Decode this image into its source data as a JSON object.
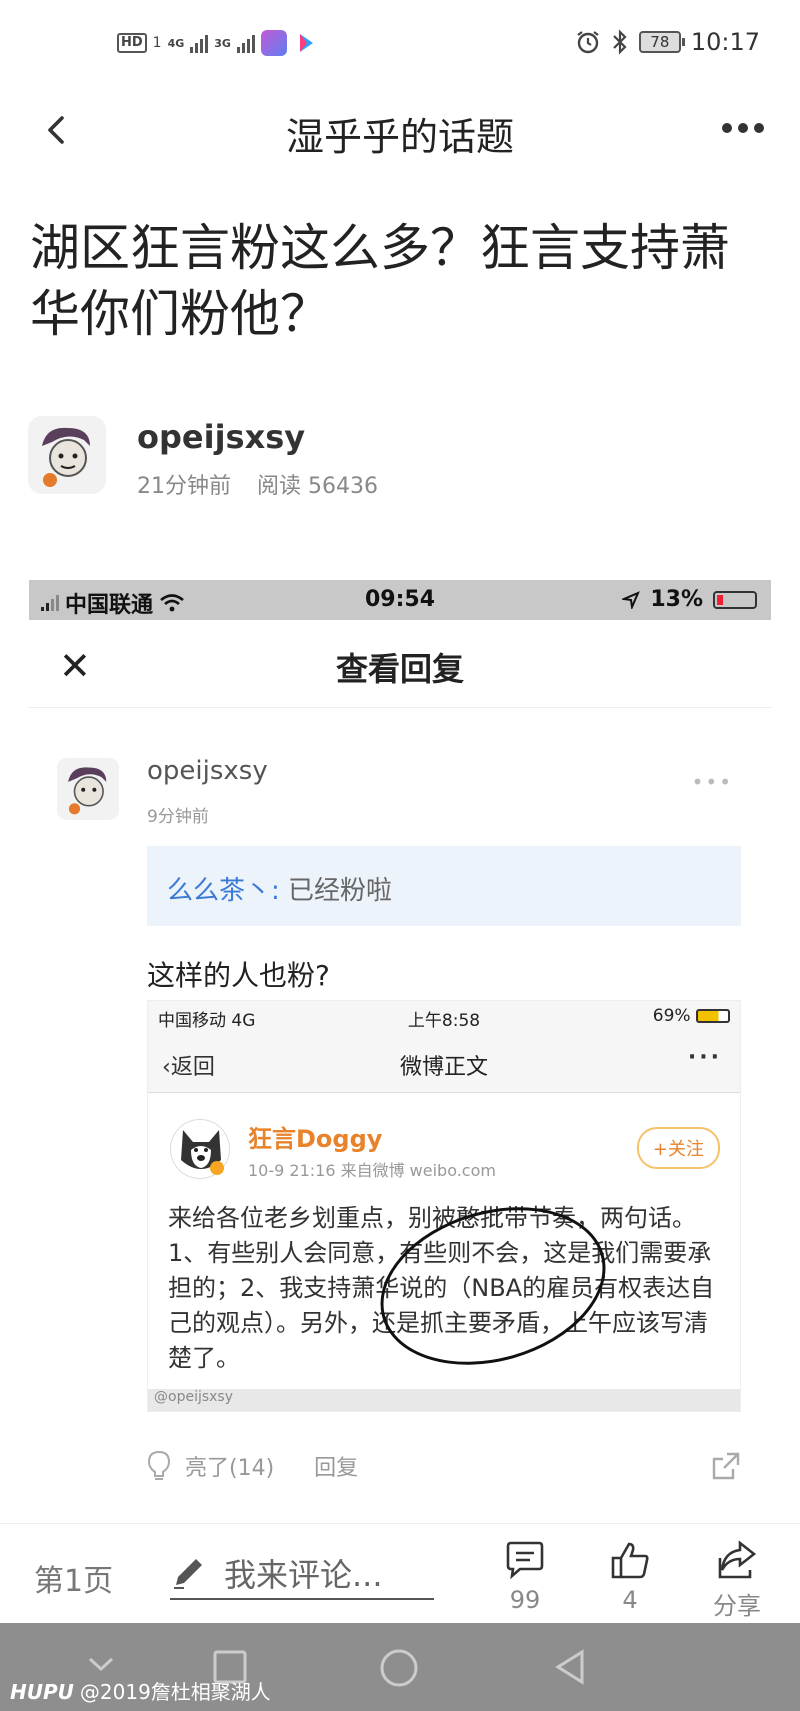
{
  "status_bar": {
    "left_hd": "HD",
    "left_sub": "1",
    "net1": "4G",
    "net2": "3G",
    "battery": "78",
    "time": "10:17"
  },
  "nav": {
    "title": "湿乎乎的话题"
  },
  "post": {
    "title": "湖区狂言粉这么多？狂言支持萧华你们粉他？",
    "author": "opeijsxsy",
    "time_ago": "21分钟前",
    "reads": "阅读 56436"
  },
  "screenshot": {
    "status": {
      "carrier": "中国联通",
      "time": "09:54",
      "battery": "13%"
    },
    "sheet_title": "查看回复",
    "reply": {
      "user": "opeijsxsy",
      "time": "9分钟前",
      "quote_user": "么么茶丶:",
      "quote_text": " 已经粉啦",
      "text": "这样的人也粉?"
    },
    "weibo": {
      "status_left": "中国移动  4G",
      "status_time": "上午8:58",
      "status_right": "69%",
      "back": "返回",
      "title": "微博正文",
      "dots": "···",
      "user": "狂言Doggy",
      "meta": "10-9 21:16  来自微博 weibo.com",
      "follow": "+关注",
      "body": "来给各位老乡划重点，别被憨批带节奏，两句话。1、有些别人会同意，有些则不会，这是我们需要承担的；2、我支持萧华说的（NBA的雇员有权表达自己的观点）。另外，还是抓主要矛盾，上午应该写清楚了。",
      "watermark": "@opeijsxsy"
    },
    "actions": {
      "likes": "亮了(14)",
      "reply": "回复"
    }
  },
  "bottom_bar": {
    "page": "第1页",
    "comment_placeholder": "我来评论...",
    "comments": "99",
    "likes": "4",
    "share": "分享"
  },
  "watermark": {
    "brand": "HUPU",
    "text": "@2019詹杜相聚湖人"
  }
}
